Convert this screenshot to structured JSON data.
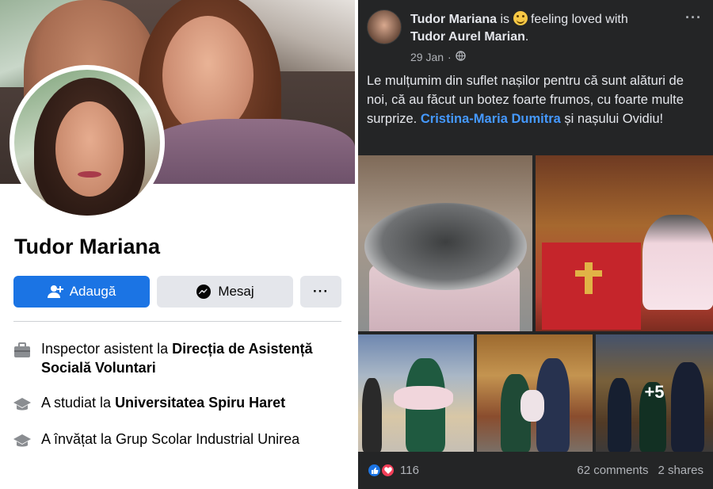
{
  "profile": {
    "name": "Tudor Mariana",
    "buttons": {
      "add_label": "Adaugă",
      "message_label": "Mesaj",
      "more_label": "···"
    },
    "intro": [
      {
        "icon": "briefcase-icon",
        "prefix": "Inspector asistent la ",
        "bold": "Direcția de Asistență Socială Voluntari"
      },
      {
        "icon": "graduation-cap-icon",
        "prefix": "A studiat la ",
        "bold": "Universitatea Spiru Haret"
      },
      {
        "icon": "graduation-cap-icon",
        "prefix": "A învățat la Grup Scolar Industrial Unirea",
        "bold": ""
      }
    ]
  },
  "post": {
    "author": "Tudor Mariana",
    "feeling_text": "is",
    "feeling_suffix": "feeling loved with",
    "tagged": "Tudor Aurel Marian",
    "tagged_end": ".",
    "date": "29 Jan",
    "date_sep": "·",
    "more_label": "···",
    "text_before": "Le mulțumim din suflet nașilor pentru că sunt alături de noi, că au făcut un botez foarte frumos, cu foarte multe surprize. ",
    "mention": "Cristina-Maria Dumitra",
    "text_after": " și nașului Ovidiu!",
    "more_photos": "+5",
    "reaction_count": "116",
    "comments": "62 comments",
    "shares": "2 shares"
  },
  "colors": {
    "accent": "#1b74e4",
    "mention": "#4599ff",
    "dark_bg": "#242526",
    "love": "#f33e58"
  }
}
